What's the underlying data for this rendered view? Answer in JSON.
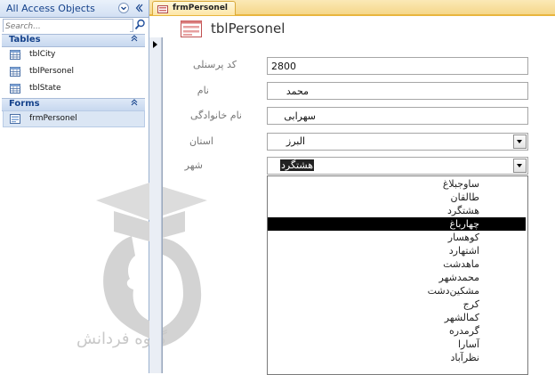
{
  "nav": {
    "title": "All Access Objects",
    "search_placeholder": "Search...",
    "groups": [
      {
        "label": "Tables",
        "items": [
          "tblCity",
          "tblPersonel",
          "tblState"
        ]
      },
      {
        "label": "Forms",
        "items": [
          "frmPersonel"
        ]
      }
    ]
  },
  "tab": {
    "label": "frmPersonel"
  },
  "form": {
    "title": "tblPersonel",
    "fields": [
      {
        "label": "کد پرسنلی",
        "value": "2800"
      },
      {
        "label": "نام",
        "value": "محمد"
      },
      {
        "label": "نام خانوادگی",
        "value": "سهرابی"
      },
      {
        "label": "استان",
        "value": "البرز"
      },
      {
        "label": "شهر",
        "value": "هشتگرد"
      }
    ]
  },
  "city_list": {
    "items": [
      "ساوجبلاغ",
      "طالقان",
      "هشتگرد",
      "چهارباغ",
      "کوهسار",
      "اشتهارد",
      "ماهدشت",
      "محمدشهر",
      "مشکین‌دشت",
      "کرج",
      "کمالشهر",
      "گرمدره",
      "آسارا",
      "نظرآباد"
    ],
    "selected_index": 3
  },
  "watermark": {
    "text": "گروه فردانش"
  },
  "colors": {
    "nav_text": "#15428b",
    "tab_active": "#fde6a6",
    "selection": "#000000"
  }
}
